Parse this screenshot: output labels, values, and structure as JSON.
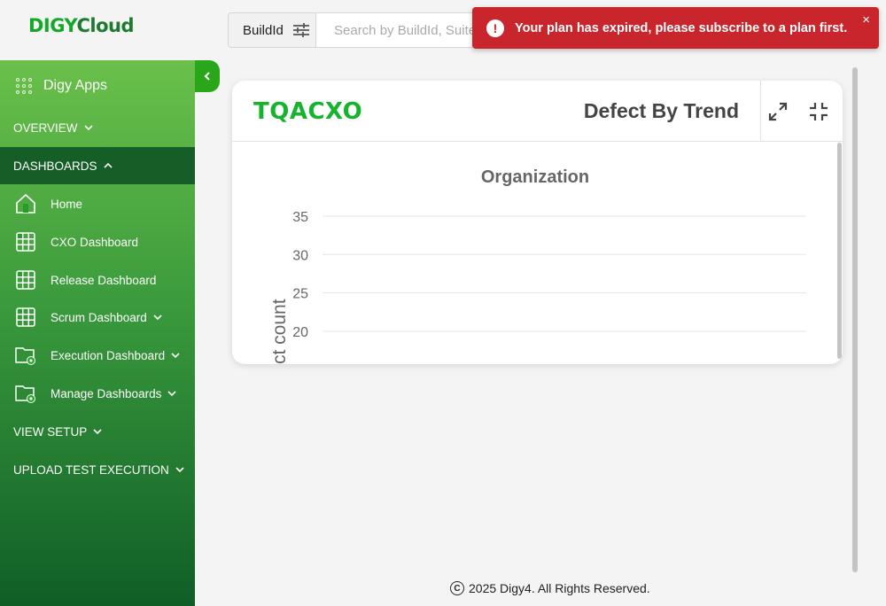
{
  "brand": {
    "part1": "DIGY",
    "part2": "Cloud"
  },
  "topbar": {
    "filter_label": "BuildId",
    "search_placeholder": "Search by BuildId, Suite"
  },
  "toast": {
    "message": "Your plan has expired, please subscribe to a plan first.",
    "close": "×",
    "icon": "!"
  },
  "sidebar": {
    "apps_label": "Digy Apps",
    "sections": {
      "overview": "OVERVIEW",
      "dashboards": "DASHBOARDS",
      "view_setup": "VIEW SETUP",
      "upload": "UPLOAD TEST EXECUTION"
    },
    "items": [
      {
        "label": "Home",
        "icon": "home-icon"
      },
      {
        "label": "CXO Dashboard",
        "icon": "grid-icon"
      },
      {
        "label": "Release Dashboard",
        "icon": "grid-icon"
      },
      {
        "label": "Scrum Dashboard",
        "icon": "grid-icon"
      },
      {
        "label": "Execution Dashboard",
        "icon": "folder-gear-icon"
      },
      {
        "label": "Manage Dashboards",
        "icon": "folder-gear-icon"
      }
    ]
  },
  "card": {
    "project": "TQACXO",
    "title": "Defect By Trend"
  },
  "chart_data": {
    "type": "line",
    "title": "Organization",
    "ylabel": "ct count",
    "yticks": [
      "35",
      "30",
      "25",
      "20"
    ],
    "ylim": [
      20,
      35
    ],
    "series": []
  },
  "footer": {
    "text": "2025 Digy4. All Rights Reserved.",
    "symbol": "C"
  }
}
